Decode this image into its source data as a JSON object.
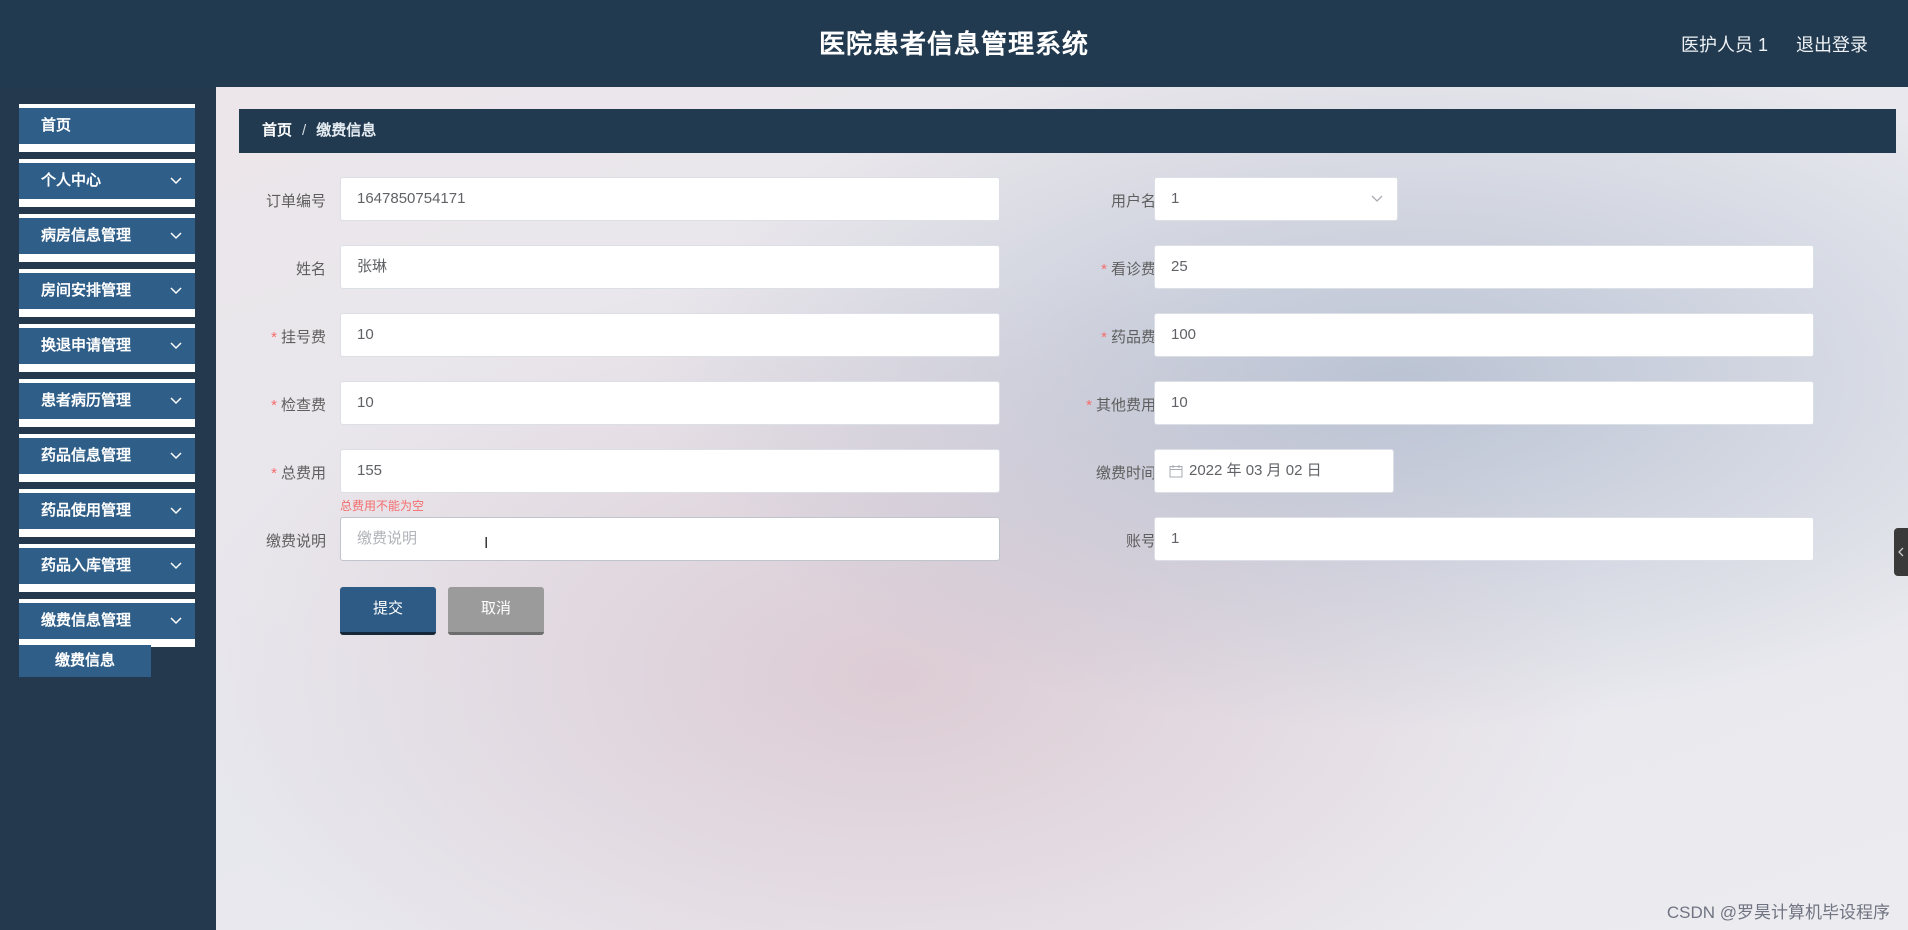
{
  "header": {
    "title": "医院患者信息管理系统",
    "user": "医护人员 1",
    "logout": "退出登录"
  },
  "sidebar": {
    "items": [
      {
        "label": "首页",
        "has_children": false
      },
      {
        "label": "个人中心",
        "has_children": true
      },
      {
        "label": "病房信息管理",
        "has_children": true
      },
      {
        "label": "房间安排管理",
        "has_children": true
      },
      {
        "label": "换退申请管理",
        "has_children": true
      },
      {
        "label": "患者病历管理",
        "has_children": true
      },
      {
        "label": "药品信息管理",
        "has_children": true
      },
      {
        "label": "药品使用管理",
        "has_children": true
      },
      {
        "label": "药品入库管理",
        "has_children": true
      },
      {
        "label": "缴费信息管理",
        "has_children": true
      }
    ],
    "sub_item": "缴费信息"
  },
  "breadcrumb": {
    "home": "首页",
    "sep": "/",
    "current": "缴费信息"
  },
  "form": {
    "order_no": {
      "label": "订单编号",
      "value": "1647850754171"
    },
    "username": {
      "label": "用户名",
      "value": "1"
    },
    "name": {
      "label": "姓名",
      "value": "张琳"
    },
    "consult_fee": {
      "label": "看诊费",
      "value": "25",
      "required": "*"
    },
    "register_fee": {
      "label": "挂号费",
      "value": "10",
      "required": "*"
    },
    "drug_fee": {
      "label": "药品费",
      "value": "100",
      "required": "*"
    },
    "exam_fee": {
      "label": "检查费",
      "value": "10",
      "required": "*"
    },
    "other_fee": {
      "label": "其他费用",
      "value": "10",
      "required": "*"
    },
    "total_fee": {
      "label": "总费用",
      "value": "155",
      "required": "*",
      "error": "总费用不能为空"
    },
    "pay_time": {
      "label": "缴费时间",
      "value": "2022 年 03 月 02 日"
    },
    "pay_note": {
      "label": "缴费说明",
      "placeholder": "缴费说明"
    },
    "account": {
      "label": "账号",
      "value": "1"
    }
  },
  "buttons": {
    "submit": "提交",
    "cancel": "取消"
  },
  "watermark": "CSDN @罗昊计算机毕设程序",
  "colors": {
    "header_bg": "#223a4f",
    "menu_bg": "#2f5f89",
    "required": "#f56c6c",
    "submit": "#2d5b85",
    "cancel": "#9b9b9b"
  }
}
